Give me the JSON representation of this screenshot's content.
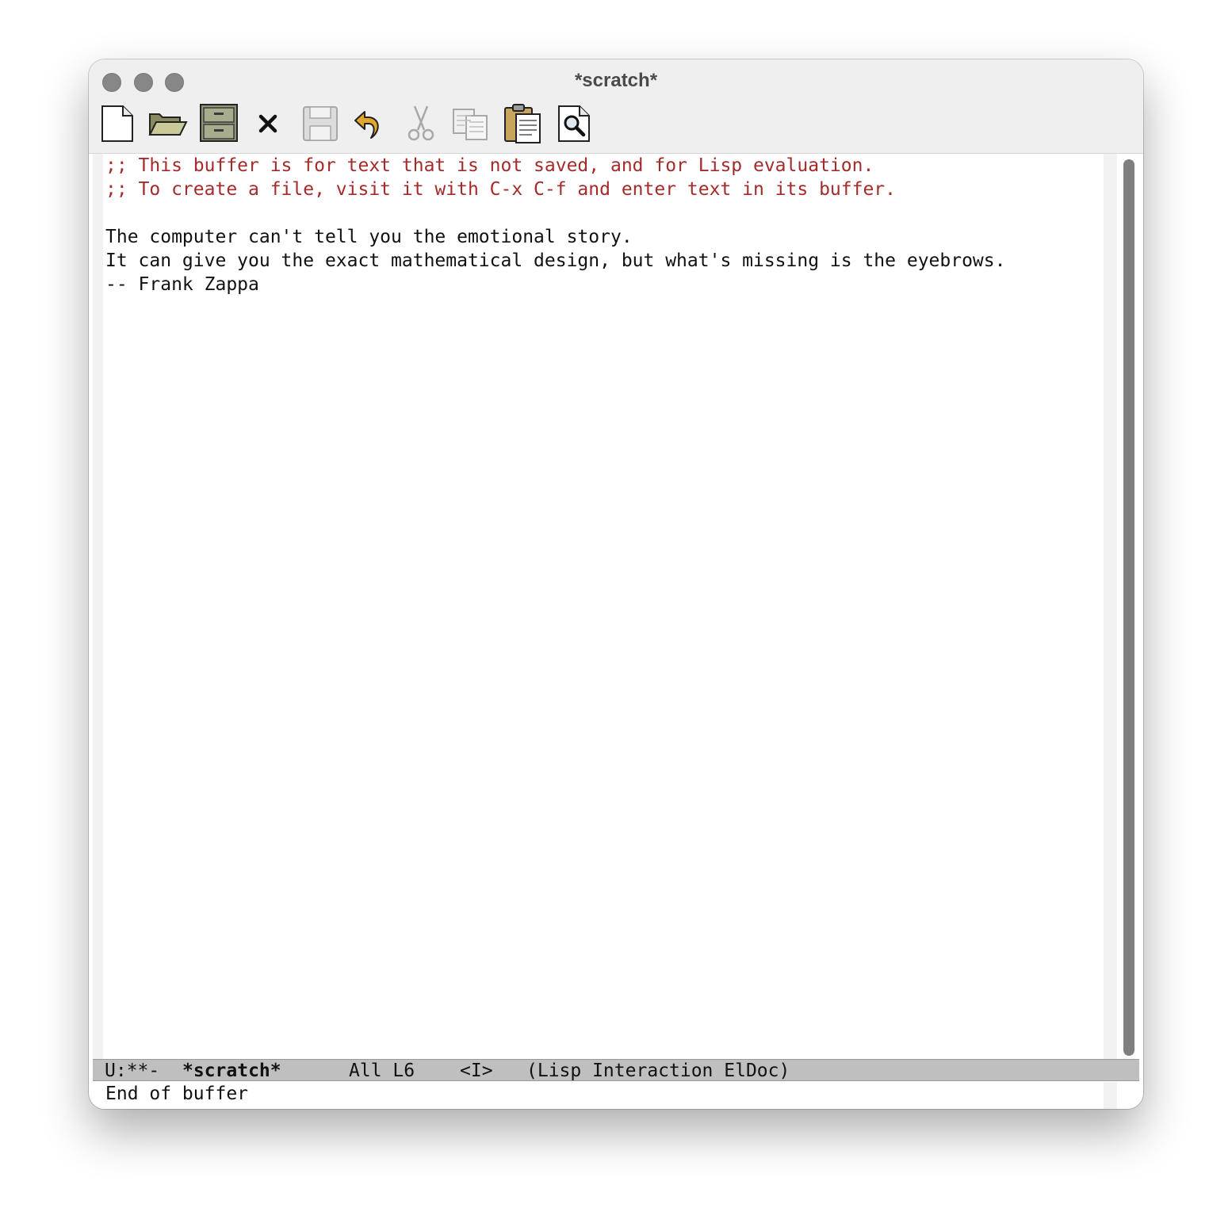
{
  "window": {
    "title": "*scratch*"
  },
  "toolbar": {
    "buttons": [
      {
        "name": "new-file",
        "icon": "new-file-icon",
        "enabled": true
      },
      {
        "name": "open-directory",
        "icon": "folder-open-icon",
        "enabled": true
      },
      {
        "name": "dired",
        "icon": "file-cabinet-icon",
        "enabled": true
      },
      {
        "name": "kill-buffer",
        "icon": "close-icon",
        "enabled": true
      },
      {
        "name": "save",
        "icon": "floppy-disk-icon",
        "enabled": false
      },
      {
        "name": "undo",
        "icon": "undo-icon",
        "enabled": true
      },
      {
        "name": "cut",
        "icon": "scissors-icon",
        "enabled": false
      },
      {
        "name": "copy",
        "icon": "copy-icon",
        "enabled": false
      },
      {
        "name": "paste",
        "icon": "clipboard-icon",
        "enabled": true
      },
      {
        "name": "search",
        "icon": "magnifier-icon",
        "enabled": true
      }
    ]
  },
  "buffer": {
    "lines": [
      ";; This buffer is for text that is not saved, and for Lisp evaluation.",
      ";; To create a file, visit it with C-x C-f and enter text in its buffer.",
      "",
      "The computer can't tell you the emotional story.",
      "It can give you the exact mathematical design, but what's missing is the eyebrows.",
      "-- Frank Zappa"
    ],
    "comment_color": "#a52a2a",
    "text_color": "#111111"
  },
  "modeline": {
    "status": "U:**-",
    "buffer_name": "*scratch*",
    "position": "All L6",
    "input_method": "<I>",
    "modes": "(Lisp Interaction ElDoc)"
  },
  "minibuffer": {
    "message": "End of buffer"
  },
  "colors": {
    "titlebar": "#efefef",
    "modeline": "#bfbfbf",
    "scrollbar_thumb": "#7f7f7f",
    "traffic_light": "#878787"
  }
}
